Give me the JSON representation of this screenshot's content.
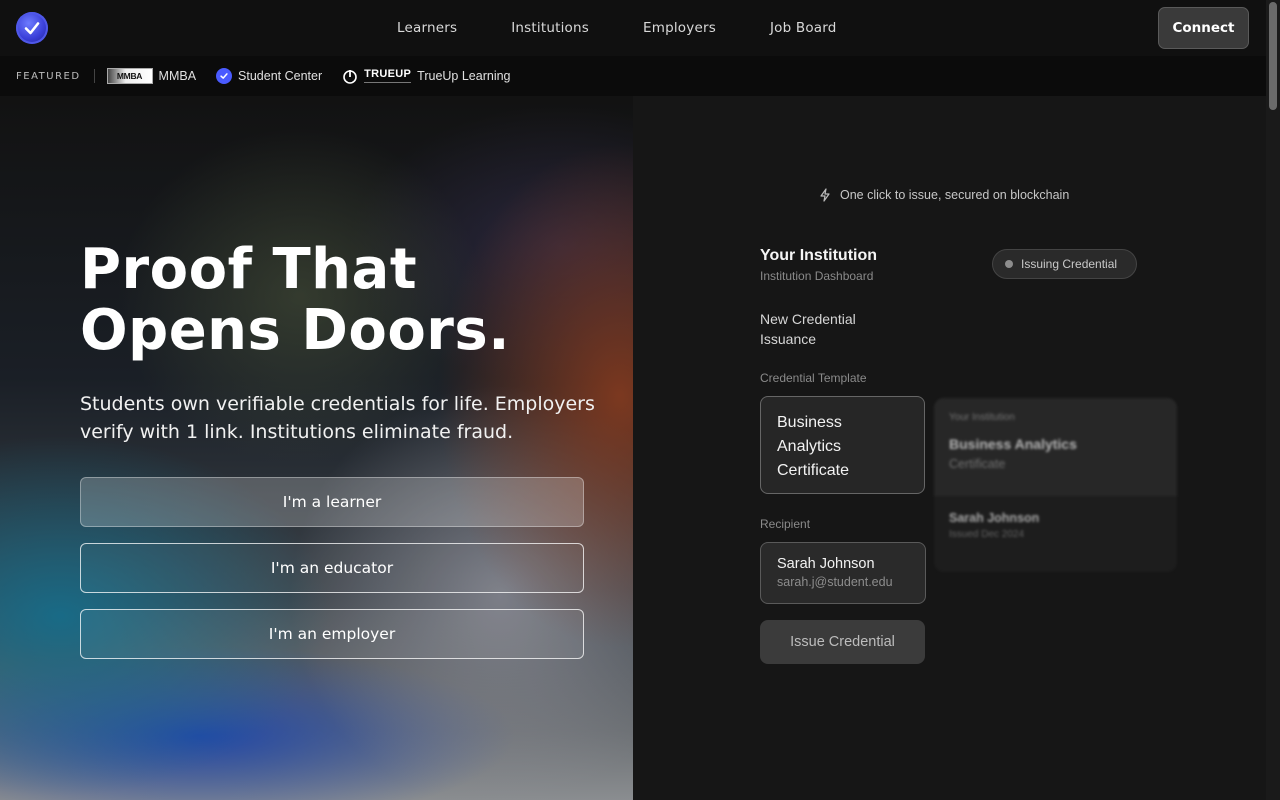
{
  "nav": {
    "links": [
      "Learners",
      "Institutions",
      "Employers",
      "Job Board"
    ],
    "connect_label": "Connect"
  },
  "featured": {
    "label": "FEATURED",
    "items": [
      {
        "logo_text": "MMBA",
        "name": "MMBA"
      },
      {
        "name": "Student Center"
      },
      {
        "logo_text": "TRUEUP",
        "name": "TrueUp Learning"
      }
    ]
  },
  "hero": {
    "title_line1": "Proof That",
    "title_line2": "Opens Doors.",
    "subtitle": "Students own verifiable credentials for life. Employers verify with 1 link. Institutions eliminate fraud.",
    "buttons": [
      "I'm a learner",
      "I'm an educator",
      "I'm an employer"
    ]
  },
  "panel": {
    "tagline": "One click to issue, secured on blockchain",
    "institution_title": "Your Institution",
    "institution_subtitle": "Institution Dashboard",
    "status": "Issuing Credential",
    "section_title": "New Credential Issuance",
    "template_label": "Credential Template",
    "template_value": "Business Analytics Certificate",
    "recipient_label": "Recipient",
    "recipient_name": "Sarah Johnson",
    "recipient_email": "sarah.j@student.edu",
    "issue_label": "Issue Credential",
    "preview": {
      "institution": "Your Institution",
      "title": "Business Analytics",
      "subtitle": "Certificate",
      "name": "Sarah Johnson",
      "date": "Issued Dec 2024"
    }
  },
  "colors": {
    "accent": "#4a5bff",
    "background": "#141414"
  }
}
